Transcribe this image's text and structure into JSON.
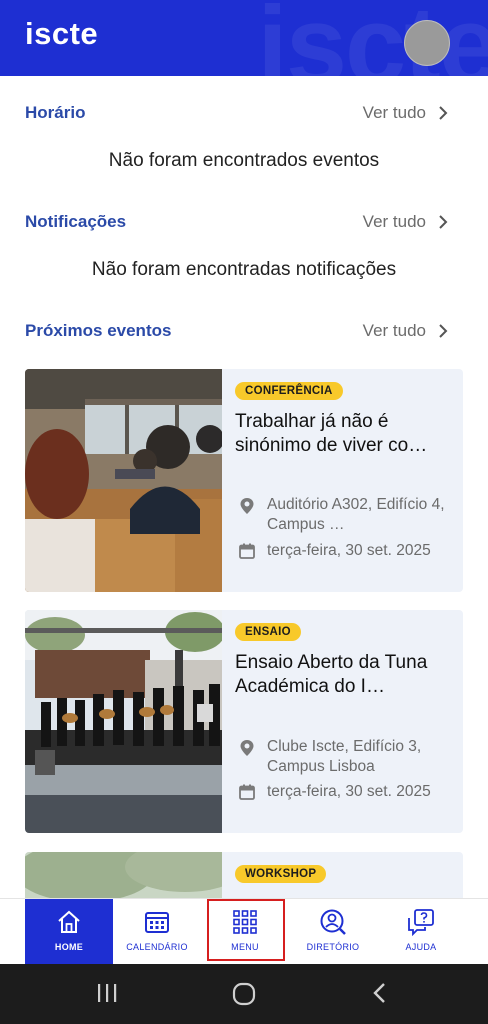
{
  "header": {
    "logo": "iscte",
    "avatar_icon": "user-avatar",
    "brand_color": "#1e2fd2"
  },
  "schedule": {
    "title": "Horário",
    "see_all": "Ver tudo",
    "empty": "Não foram encontrados eventos"
  },
  "notifications": {
    "title": "Notificações",
    "see_all": "Ver tudo",
    "empty": "Não foram encontradas notificações"
  },
  "events": {
    "title": "Próximos eventos",
    "see_all": "Ver tudo",
    "items": [
      {
        "badge": "CONFERÊNCIA",
        "title": "Trabalhar já não é sinónimo de viver co…",
        "location": "Auditório A302, Edifício 4, Campus …",
        "date": "terça-feira, 30 set. 2025"
      },
      {
        "badge": "ENSAIO",
        "title": "Ensaio Aberto da Tuna Académica do I…",
        "location": "Clube Iscte, Edifício 3, Campus Lisboa",
        "date": "terça-feira, 30 set. 2025"
      },
      {
        "badge": "WORKSHOP"
      }
    ]
  },
  "bottom_nav": {
    "items": [
      {
        "label": "HOME",
        "icon": "home-icon",
        "active": true
      },
      {
        "label": "CALENDÁRIO",
        "icon": "calendar-icon"
      },
      {
        "label": "MENU",
        "icon": "grid-menu-icon"
      },
      {
        "label": "DIRETÓRIO",
        "icon": "person-search-icon"
      },
      {
        "label": "AJUDA",
        "icon": "help-chat-icon"
      }
    ]
  },
  "system_nav": {
    "icons": [
      "recents-icon",
      "home-circle-icon",
      "back-icon"
    ]
  }
}
